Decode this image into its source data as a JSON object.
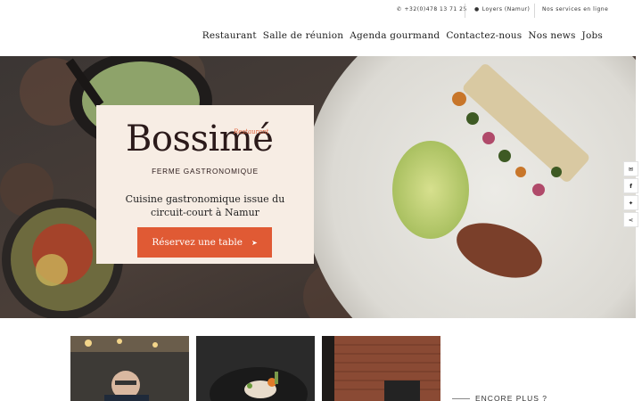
{
  "topbar": {
    "phone": "+32(0)478 13 71 25",
    "location": "Loyers (Namur)",
    "services": "Nos services en ligne",
    "phone_icon": "phone-icon",
    "location_icon": "map-marker-icon"
  },
  "nav": {
    "items": [
      "Restaurant",
      "Salle de réunion",
      "Agenda gourmand",
      "Contactez-nous",
      "Nos news",
      "Jobs"
    ]
  },
  "hero": {
    "restaurant_label": "Restaurant",
    "brand": "Bossimé",
    "subtitle": "FERME GASTRONOMIQUE",
    "tagline_line1": "Cuisine gastronomique issue du",
    "tagline_line2": "circuit-court à Namur",
    "cta_label": "Réservez une table",
    "cta_icon": "arrow-right-icon"
  },
  "social": [
    "envelope-icon",
    "facebook-icon",
    "twitter-icon",
    "share-icon"
  ],
  "gallery": {
    "encore": "ENCORE PLUS ?"
  },
  "colors": {
    "accent": "#e05a34",
    "card_bg": "#f7ede4",
    "brand_text": "#2b1a1a"
  }
}
